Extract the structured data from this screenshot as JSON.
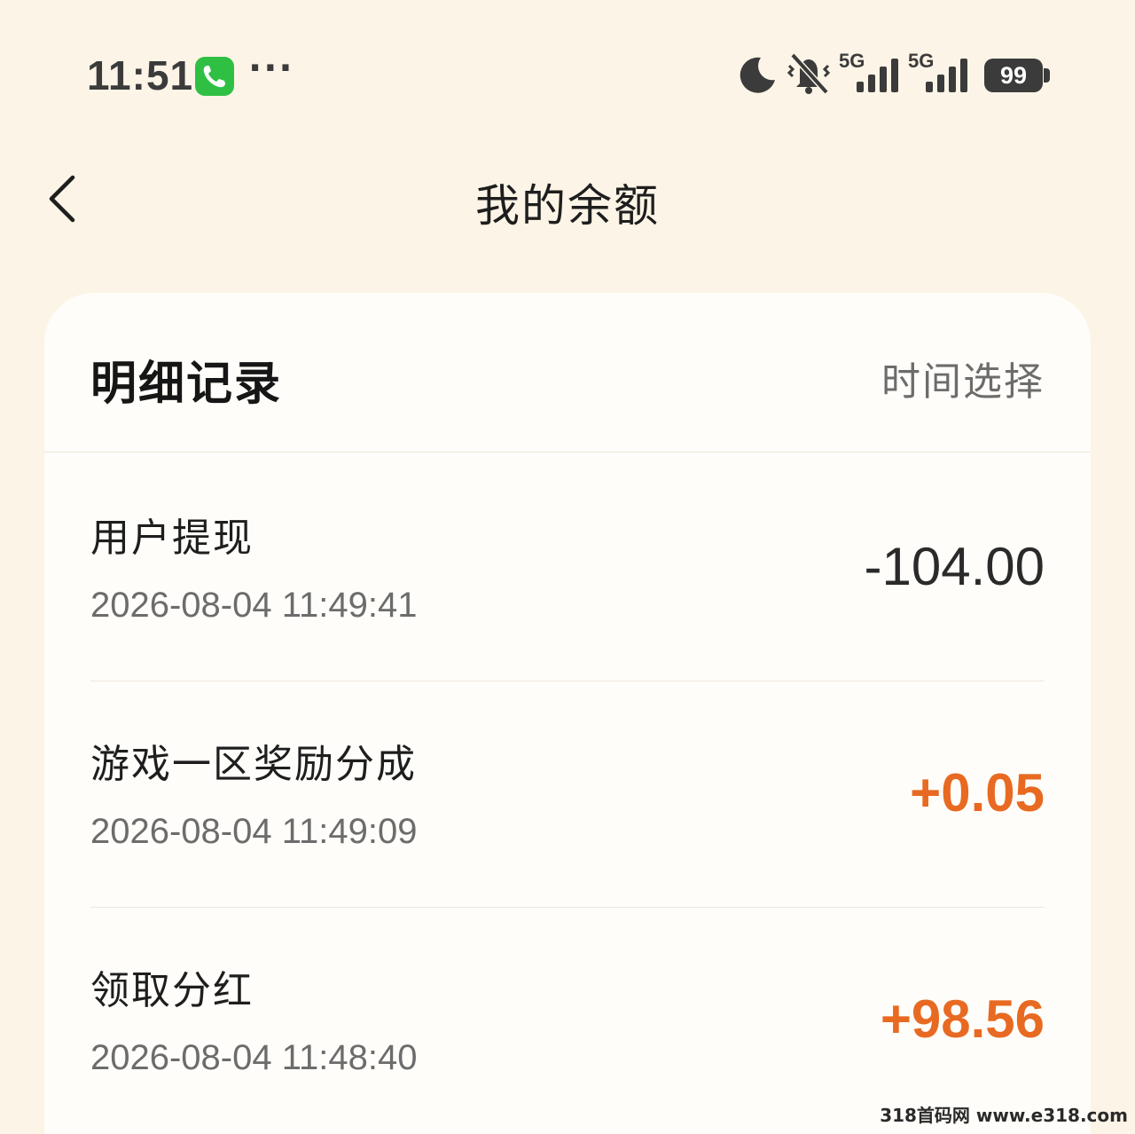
{
  "status_bar": {
    "time": "11:51",
    "more": "···",
    "signal_1": "5G",
    "signal_2": "5G",
    "battery": "99",
    "icons": [
      "phone-call-icon",
      "moon-icon",
      "mute-icon",
      "signal-icon",
      "battery-icon"
    ],
    "call_color": "#2fc043"
  },
  "header": {
    "title": "我的余额"
  },
  "details": {
    "section_title": "明细记录",
    "filter_label": "时间选择",
    "records": [
      {
        "title": "用户提现",
        "time": "2026-08-04 11:49:41",
        "amount": "-104.00"
      },
      {
        "title": "游戏一区奖励分成",
        "time": "2026-08-04 11:49:09",
        "amount": "+0.05"
      },
      {
        "title": "领取分红",
        "time": "2026-08-04 11:48:40",
        "amount": "+98.56"
      }
    ],
    "colors": {
      "positive": "#e86a22",
      "negative": "#2a2a2a"
    }
  },
  "watermark": "318首码网 www.e318.com"
}
